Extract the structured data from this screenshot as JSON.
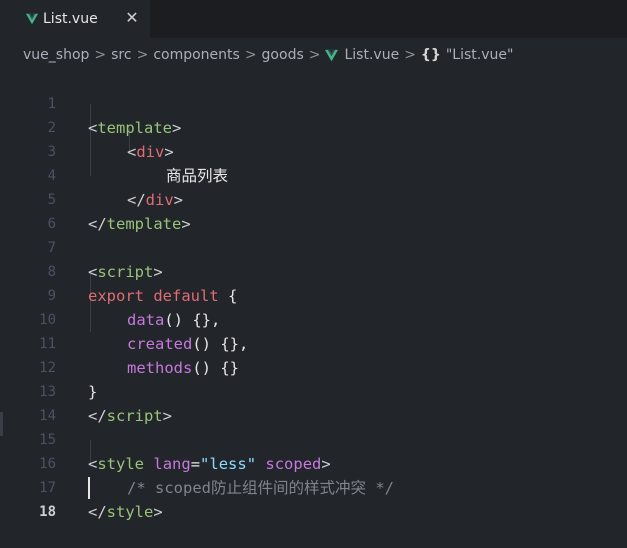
{
  "tab": {
    "title": "List.vue",
    "close_glyph": "✕",
    "icon": "vue-icon"
  },
  "breadcrumb": {
    "items": [
      "vue_shop",
      "src",
      "components",
      "goods"
    ],
    "separator": ">",
    "file": "List.vue",
    "symbol_icon": "{}",
    "symbol": "\"List.vue\""
  },
  "colors": {
    "background": "#22252a",
    "tabbar": "#1b1d21",
    "vue_green": "#41b883",
    "vue_dark": "#35495e",
    "tag": "#98c379",
    "keyword": "#e06c75",
    "function": "#c678dd",
    "string": "#89ddff",
    "comment": "#7f848e"
  },
  "editor": {
    "active_line": 18,
    "lines": [
      {
        "n": "1"
      },
      {
        "n": "2"
      },
      {
        "n": "3"
      },
      {
        "n": "4"
      },
      {
        "n": "5"
      },
      {
        "n": "6"
      },
      {
        "n": "7"
      },
      {
        "n": "8"
      },
      {
        "n": "9"
      },
      {
        "n": "10"
      },
      {
        "n": "11"
      },
      {
        "n": "12"
      },
      {
        "n": "13"
      },
      {
        "n": "14"
      },
      {
        "n": "15"
      },
      {
        "n": "16"
      },
      {
        "n": "17"
      },
      {
        "n": "18"
      }
    ],
    "tokens": {
      "lt": "<",
      "gt": ">",
      "close_open": "</",
      "template": "template",
      "div": "div",
      "script": "script",
      "style": "style",
      "text_cn": "商品列表",
      "export": "export",
      "default": "default",
      "brace_open": "{",
      "brace_close": "}",
      "data": "data",
      "created": "created",
      "methods": "methods",
      "call_tail": "() {},",
      "call_tail_last": "() {}",
      "lang": "lang",
      "eq": "=",
      "less": "\"less\"",
      "scoped": "scoped",
      "comment": "/* scoped防止组件间的样式冲突 */"
    }
  }
}
